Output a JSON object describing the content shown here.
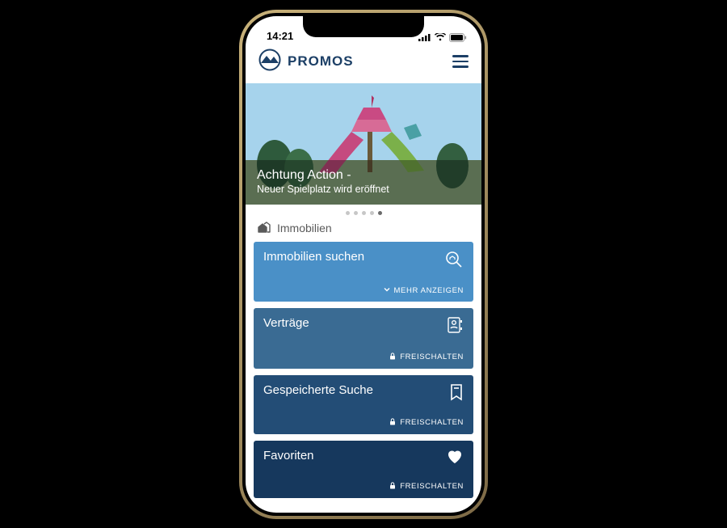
{
  "status": {
    "time": "14:21"
  },
  "brand": {
    "name": "PROMOS"
  },
  "hero": {
    "title": "Achtung Action -",
    "subtitle": "Neuer Spielplatz wird eröffnet",
    "active_dot_index": 4,
    "dot_count": 5
  },
  "section": {
    "title": "Immobilien"
  },
  "cards": [
    {
      "title": "Immobilien suchen",
      "action": "MEHR ANZEIGEN",
      "action_icon": "chevron-down",
      "icon": "search-home"
    },
    {
      "title": "Verträge",
      "action": "FREISCHALTEN",
      "action_icon": "lock",
      "icon": "contract"
    },
    {
      "title": "Gespeicherte Suche",
      "action": "FREISCHALTEN",
      "action_icon": "lock",
      "icon": "bookmark"
    },
    {
      "title": "Favoriten",
      "action": "FREISCHALTEN",
      "action_icon": "lock",
      "icon": "heart"
    }
  ],
  "colors": {
    "brand": "#1c3f66",
    "card0": "#4a90c7",
    "card1": "#3a6b93",
    "card2": "#234d76",
    "card3": "#16385d"
  }
}
